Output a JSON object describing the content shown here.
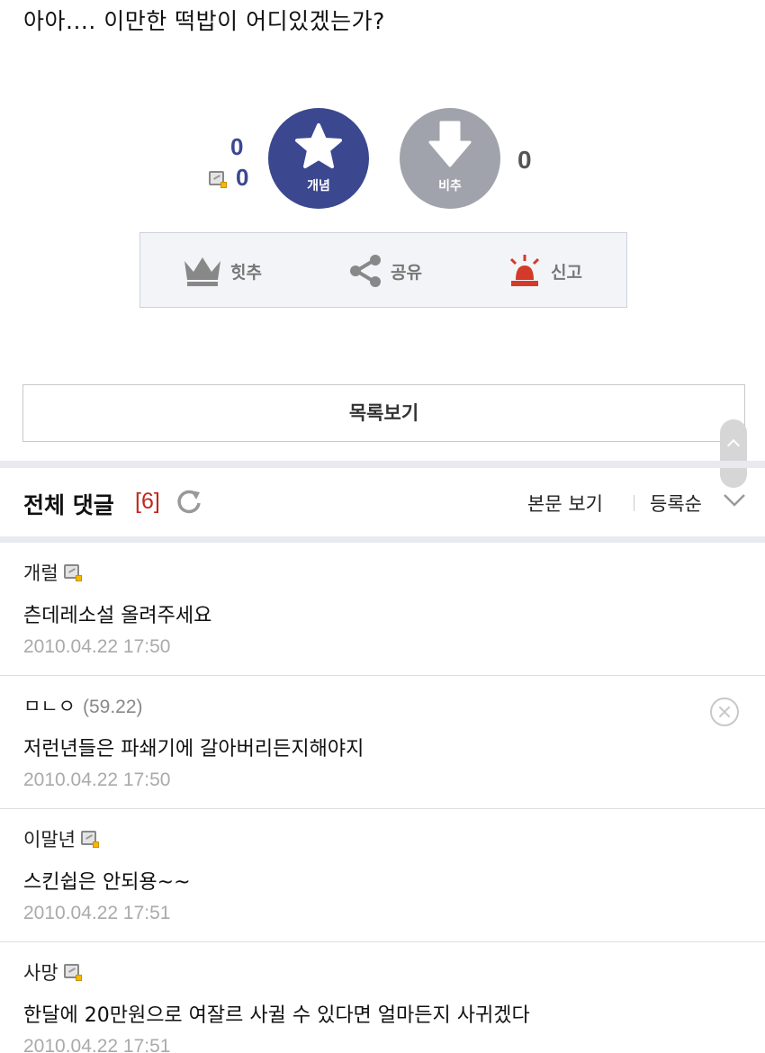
{
  "post": {
    "text": "아아.... 이만한 떡밥이 어디있겠는가?"
  },
  "recommend": {
    "up_count": "0",
    "up_fix_count": "0",
    "up_label": "개념",
    "down_label": "비추",
    "down_count": "0",
    "up_color": "#3b4890",
    "down_color": "#a0a3ab"
  },
  "actions": {
    "hit_label": "힛추",
    "share_label": "공유",
    "report_label": "신고"
  },
  "list_button": "목록보기",
  "comments_header": {
    "title": "전체 댓글",
    "count": "[6]",
    "view_body": "본문 보기",
    "sort": "등록순"
  },
  "comments": [
    {
      "name": "개럴",
      "ip": "",
      "text": "츤데레소설 올려주세요",
      "date": "2010.04.22 17:50"
    },
    {
      "name": "ㅁㄴㅇ",
      "ip": "(59.22)",
      "text": "저런년들은 파쇄기에 갈아버리든지해야지",
      "date": "2010.04.22 17:50"
    },
    {
      "name": "이말년",
      "ip": "",
      "text": "스킨쉽은 안되용~~",
      "date": "2010.04.22 17:51"
    },
    {
      "name": "사망",
      "ip": "",
      "text": "한달에 20만원으로 여잘르 사귈 수 있다면 얼마든지 사귀겠다",
      "date": "2010.04.22 17:51"
    }
  ]
}
